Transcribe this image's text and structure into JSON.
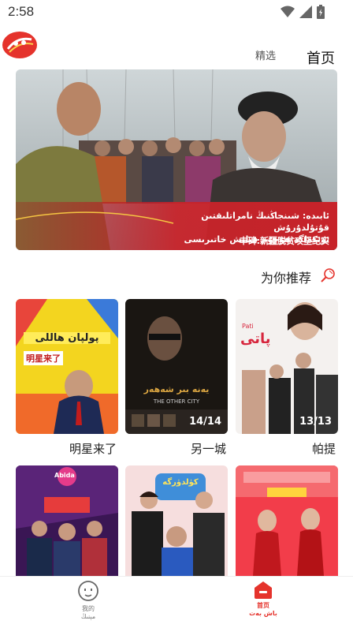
{
  "status": {
    "time": "2:58"
  },
  "header": {
    "tab_featured": "精选",
    "tab_home": "首页"
  },
  "banner": {
    "rtl_line1": "ئابىدە: شىنجاڭنىڭ نامراتلىقتىن قۇتۇلدۇرۇش",
    "rtl_line2": "ئۆتكەلگە ھۇجۇم قىلىش خاتىرىسى",
    "caption": "丰碑:新疆脱贫攻坚纪实"
  },
  "section": {
    "title": "为你推荐",
    "icon": "magnifier-icon"
  },
  "cards": [
    {
      "label": "明星来了",
      "poster_text": "پولپان ھاللى",
      "poster_sub": "明星来了",
      "count": ""
    },
    {
      "label": "另一城",
      "poster_text": "يەنە بىر شەھەر",
      "poster_sub": "THE OTHER CITY",
      "count": "14/14"
    },
    {
      "label": "帕提",
      "poster_text": "پاتى",
      "poster_sub": "Pati",
      "count": "13/13"
    },
    {
      "label": "",
      "poster_text": "Abida",
      "poster_sub": "",
      "count": ""
    },
    {
      "label": "",
      "poster_text": "كۈلدۈرگە",
      "poster_sub": "",
      "count": ""
    },
    {
      "label": "",
      "poster_text": "",
      "poster_sub": "",
      "count": ""
    }
  ],
  "nav": {
    "mine_label_cn": "我的",
    "mine_label_ug": "مېنىڭ",
    "home_label_cn": "首页",
    "home_label_ug": "باش بەت"
  },
  "colors": {
    "accent": "#e5332c",
    "banner_red": "#c7232a"
  }
}
